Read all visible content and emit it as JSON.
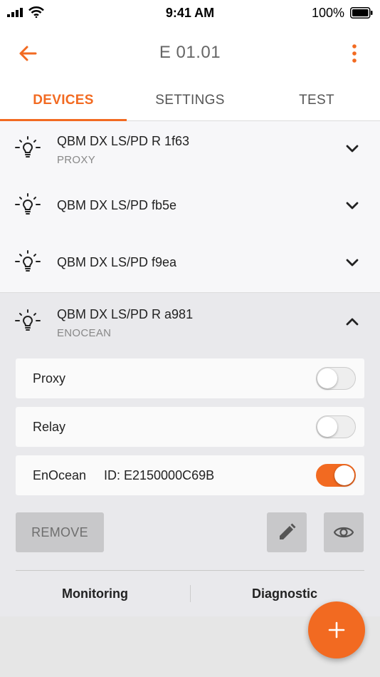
{
  "status_bar": {
    "time": "9:41 AM",
    "battery_percent": "100%"
  },
  "header": {
    "title": "E 01.01"
  },
  "tabs": [
    {
      "label": "DEVICES",
      "active": true
    },
    {
      "label": "SETTINGS",
      "active": false
    },
    {
      "label": "TEST",
      "active": false
    }
  ],
  "devices": [
    {
      "name": "QBM DX LS/PD R 1f63",
      "subtitle": "PROXY"
    },
    {
      "name": "QBM DX LS/PD fb5e",
      "subtitle": ""
    },
    {
      "name": "QBM DX LS/PD f9ea",
      "subtitle": ""
    }
  ],
  "expanded_device": {
    "name": "QBM DX LS/PD R a981",
    "subtitle": "ENOCEAN",
    "settings": [
      {
        "label": "Proxy",
        "on": false
      },
      {
        "label": "Relay",
        "on": false
      },
      {
        "label": "EnOcean",
        "id": "ID: E2150000C69B",
        "on": true
      }
    ],
    "remove_label": "REMOVE",
    "links": {
      "monitoring": "Monitoring",
      "diagnostic": "Diagnostic"
    }
  },
  "icons": {
    "back": "arrow-left-icon",
    "menu": "more-vertical-icon",
    "device": "lightbulb-icon",
    "edit": "pencil-icon",
    "view": "eye-icon",
    "fab": "plus-icon"
  },
  "colors": {
    "accent": "#f26a21",
    "text": "#222222",
    "muted": "#888888"
  }
}
